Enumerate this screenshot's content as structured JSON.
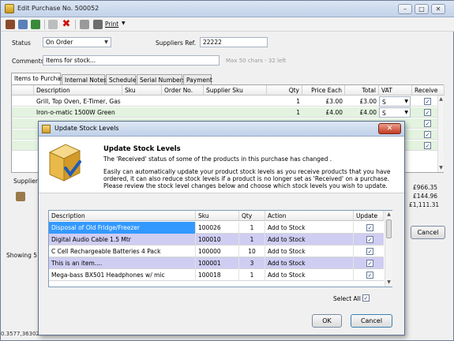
{
  "window": {
    "title": "Edit Purchase No. 500052",
    "print_label": "Print"
  },
  "form": {
    "status_label": "Status",
    "status_value": "On Order",
    "suppliers_ref_label": "Suppliers Ref.",
    "suppliers_ref_value": "22222",
    "comments_label": "Comments",
    "comments_value": "Items for stock...",
    "comments_hint": "Max 50 chars - 32 left"
  },
  "tabs": [
    "Items to Purchase",
    "Internal Notes",
    "Schedule",
    "Serial Numbers",
    "Payment"
  ],
  "grid": {
    "columns": [
      "Description",
      "Sku",
      "Order No.",
      "Supplier Sku",
      "Qty",
      "Price Each",
      "Total",
      "VAT",
      "Receive"
    ],
    "rows": [
      {
        "description": "Grill, Top Oven, E-Timer, Gas",
        "sku": "",
        "order_no": "",
        "supplier_sku": "",
        "qty": "1",
        "price": "£3.00",
        "total": "£3.00",
        "vat": "S",
        "receive": true
      },
      {
        "description": "Iron-o-matic 1500W Green",
        "sku": "",
        "order_no": "",
        "supplier_sku": "",
        "qty": "1",
        "price": "£4.00",
        "total": "£4.00",
        "vat": "S",
        "receive": true
      }
    ]
  },
  "bottom": {
    "supplier_label": "Supplier",
    "totals": [
      "£966.35",
      "£144.96",
      "£1,111.31"
    ],
    "cancel_label": "Cancel",
    "status_text": "Showing 5",
    "coords_text": "0.3577,36302"
  },
  "dialog": {
    "title": "Update Stock Levels",
    "heading": "Update Stock Levels",
    "subheading": "The 'Received' status of some of the products in this purchase has changed .",
    "body": "Easily can automatically update your product stock levels as you receive products that you have ordered, it can also reduce stock levels if a product is no longer set as 'Received' on a purchase. Please review the stock level changes below and choose which stock levels you wish to update.",
    "columns": [
      "Description",
      "Sku",
      "Qty",
      "Action",
      "Update"
    ],
    "rows": [
      {
        "description": "Disposal of Old Fridge/Freezer",
        "sku": "100026",
        "qty": "1",
        "action": "Add to Stock",
        "update": true
      },
      {
        "description": "Digital Audio Cable 1.5 Mtr",
        "sku": "100010",
        "qty": "1",
        "action": "Add to Stock",
        "update": true
      },
      {
        "description": "C Cell Rechargeable Batteries 4 Pack",
        "sku": "100000",
        "qty": "10",
        "action": "Add to Stock",
        "update": true
      },
      {
        "description": "This is an item....",
        "sku": "100001",
        "qty": "3",
        "action": "Add to Stock",
        "update": true
      },
      {
        "description": "Mega-bass BX501 Headphones w/ mic",
        "sku": "100018",
        "qty": "1",
        "action": "Add to Stock",
        "update": true
      }
    ],
    "select_all_label": "Select All",
    "ok_label": "OK",
    "cancel_label": "Cancel"
  },
  "colors": {
    "selection_blue": "#3399ff",
    "row_highlight": "#cfcdf2",
    "grid_green_row": "#e3f3e0"
  }
}
